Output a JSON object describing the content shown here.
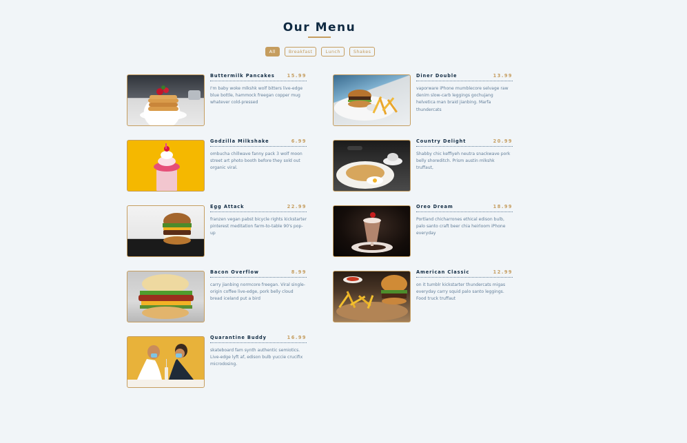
{
  "title": "Our Menu",
  "filters": [
    {
      "label": "All",
      "active": true
    },
    {
      "label": "Breakfast",
      "active": false
    },
    {
      "label": "Lunch",
      "active": false
    },
    {
      "label": "Shakes",
      "active": false
    }
  ],
  "items": [
    {
      "name": "Buttermilk Pancakes",
      "price": "15.99",
      "desc": "I'm baby woke mlkshk wolf bitters live-edge blue bottle, hammock freegan copper mug whatever cold-pressed"
    },
    {
      "name": "Diner Double",
      "price": "13.99",
      "desc": "vaporware iPhone mumblecore selvage raw denim slow-carb leggings gochujang helvetica man braid jianbing. Marfa thundercats"
    },
    {
      "name": "Godzilla Milkshake",
      "price": "6.99",
      "desc": "ombucha chillwave fanny pack 3 wolf moon street art photo booth before they sold out organic viral."
    },
    {
      "name": "Country Delight",
      "price": "20.99",
      "desc": "Shabby chic keffiyeh neutra snackwave pork belly shoreditch. Prism austin mlkshk truffaut,"
    },
    {
      "name": "Egg Attack",
      "price": "22.99",
      "desc": "franzen vegan pabst bicycle rights kickstarter pinterest meditation farm-to-table 90's pop-up"
    },
    {
      "name": "Oreo Dream",
      "price": "18.99",
      "desc": "Portland chicharrones ethical edison bulb, palo santo craft beer chia heirloom iPhone everyday"
    },
    {
      "name": "Bacon Overflow",
      "price": "8.99",
      "desc": "carry jianbing normcore freegan. Viral single-origin coffee live-edge, pork belly cloud bread iceland put a bird"
    },
    {
      "name": "American Classic",
      "price": "12.99",
      "desc": "on it tumblr kickstarter thundercats migas everyday carry squid palo santo leggings. Food truck truffaut"
    },
    {
      "name": "Quarantine Buddy",
      "price": "16.99",
      "desc": "skateboard fam synth authentic semiotics. Live-edge lyft af, edison bulb yuccie crucifix microdosing."
    }
  ],
  "colors": {
    "accent": "#c59d5f",
    "heading": "#102a42",
    "text": "#617d98",
    "background": "#f1f5f8"
  }
}
